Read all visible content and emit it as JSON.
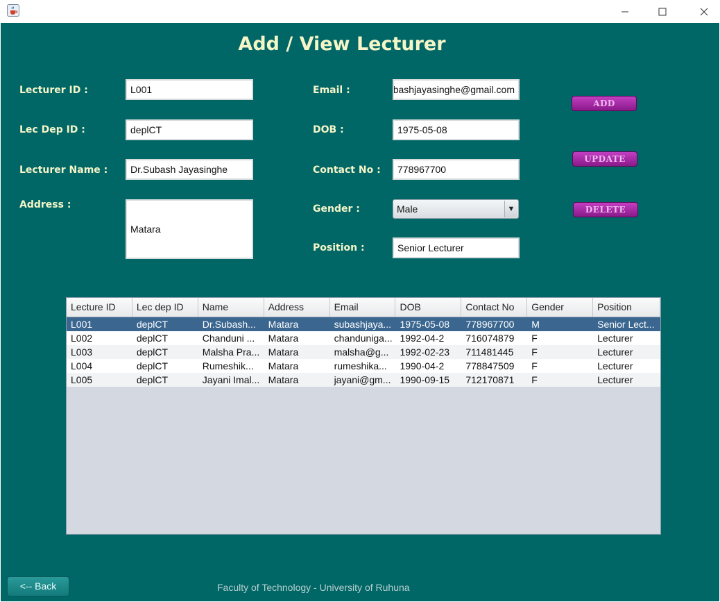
{
  "window": {
    "title": "",
    "icon": "java-coffee-icon"
  },
  "page": {
    "title": "Add / View Lecturer"
  },
  "form": {
    "lecturer_id_label": "Lecturer ID :",
    "lecturer_id_value": "L001",
    "lec_dep_id_label": "Lec Dep ID :",
    "lec_dep_id_value": "deplCT",
    "lecturer_name_label": "Lecturer Name :",
    "lecturer_name_value": "Dr.Subash Jayasinghe",
    "address_label": "Address :",
    "address_value": "Matara",
    "email_label": "Email :",
    "email_value": "subashjayasinghe@gmail.com",
    "dob_label": "DOB :",
    "dob_value": "1975-05-08",
    "contact_label": "Contact No :",
    "contact_value": "778967700",
    "gender_label": "Gender :",
    "gender_value": "Male",
    "position_label": "Position :",
    "position_value": "Senior Lecturer"
  },
  "actions": {
    "add": "ADD",
    "update": "UPDATE",
    "delete": "DELETE"
  },
  "table": {
    "columns": [
      "Lecture ID",
      "Lec dep ID",
      "Name",
      "Address",
      "Email",
      "DOB",
      "Contact No",
      "Gender",
      "Position"
    ],
    "rows": [
      [
        "L001",
        "deplCT",
        "Dr.Subash...",
        "Matara",
        "subashjaya...",
        "1975-05-08",
        "778967700",
        "M",
        "Senior Lect..."
      ],
      [
        "L002",
        "deplCT",
        "Chanduni ...",
        "Matara",
        "chanduniga...",
        "1992-04-2",
        "716074879",
        "F",
        "Lecturer"
      ],
      [
        "L003",
        "deplCT",
        "Malsha Pra...",
        "Matara",
        "malsha@g...",
        "1992-02-23",
        "711481445",
        "F",
        "Lecturer"
      ],
      [
        "L004",
        "deplCT",
        "Rumeshik...",
        "Matara",
        "rumeshika...",
        "1990-04-2",
        "778847509",
        "F",
        "Lecturer"
      ],
      [
        "L005",
        "deplCT",
        "Jayani Imal...",
        "Matara",
        "jayani@gm...",
        "1990-09-15",
        "712170871",
        "F",
        "Lecturer"
      ]
    ],
    "selected_row": 0
  },
  "footer": {
    "back": "<-- Back",
    "text": "Faculty of Technology - University of Ruhuna"
  },
  "colors": {
    "background": "#006666",
    "label": "#f5f5c8",
    "button": "#a52aa5",
    "selected_row": "#3a6690"
  }
}
